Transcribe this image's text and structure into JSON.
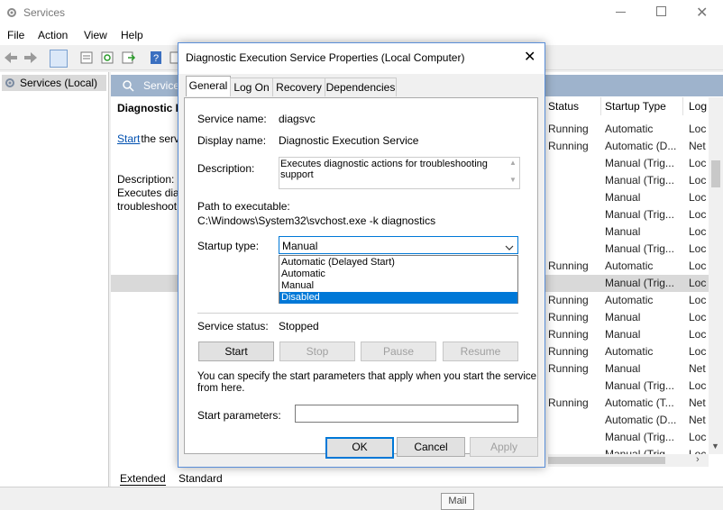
{
  "window": {
    "title": "Services"
  },
  "menu": [
    "File",
    "Action",
    "View",
    "Help"
  ],
  "tree": {
    "root": "Services (Local)"
  },
  "pane": {
    "header": "Services",
    "heading": "Diagnostic E",
    "start_link": "Start",
    "start_text": " the serv",
    "desc_label": "Description:",
    "desc_line1": "Executes diag",
    "desc_line2": "troubleshoot"
  },
  "columns": {
    "status": "Status",
    "startup": "Startup Type",
    "logon": "Log"
  },
  "rows": [
    {
      "status": "Running",
      "startup": "Automatic",
      "logon": "Loc"
    },
    {
      "status": "Running",
      "startup": "Automatic (D...",
      "logon": "Net"
    },
    {
      "status": "",
      "startup": "Manual (Trig...",
      "logon": "Loc"
    },
    {
      "status": "",
      "startup": "Manual (Trig...",
      "logon": "Loc"
    },
    {
      "status": "",
      "startup": "Manual",
      "logon": "Loc"
    },
    {
      "status": "",
      "startup": "Manual (Trig...",
      "logon": "Loc"
    },
    {
      "status": "",
      "startup": "Manual",
      "logon": "Loc"
    },
    {
      "status": "",
      "startup": "Manual (Trig...",
      "logon": "Loc"
    },
    {
      "status": "Running",
      "startup": "Automatic",
      "logon": "Loc"
    },
    {
      "status": "",
      "startup": "Manual (Trig...",
      "logon": "Loc"
    },
    {
      "status": "Running",
      "startup": "Automatic",
      "logon": "Loc"
    },
    {
      "status": "Running",
      "startup": "Manual",
      "logon": "Loc"
    },
    {
      "status": "Running",
      "startup": "Manual",
      "logon": "Loc"
    },
    {
      "status": "Running",
      "startup": "Automatic",
      "logon": "Loc"
    },
    {
      "status": "Running",
      "startup": "Manual",
      "logon": "Net"
    },
    {
      "status": "",
      "startup": "Manual (Trig...",
      "logon": "Loc"
    },
    {
      "status": "Running",
      "startup": "Automatic (T...",
      "logon": "Net"
    },
    {
      "status": "",
      "startup": "Automatic (D...",
      "logon": "Net"
    },
    {
      "status": "",
      "startup": "Manual (Trig...",
      "logon": "Loc"
    },
    {
      "status": "",
      "startup": "Manual (Trig",
      "logon": "Loc"
    }
  ],
  "bottom_tabs": [
    "Extended",
    "Standard"
  ],
  "statusbar": {
    "tooltip": "Mail"
  },
  "dialog": {
    "title": "Diagnostic Execution Service Properties (Local Computer)",
    "tabs": [
      "General",
      "Log On",
      "Recovery",
      "Dependencies"
    ],
    "service_name_label": "Service name:",
    "service_name": "diagsvc",
    "display_name_label": "Display name:",
    "display_name": "Diagnostic Execution Service",
    "description_label": "Description:",
    "description_line1": "Executes diagnostic actions for troubleshooting",
    "description_line2": "support",
    "path_label": "Path to executable:",
    "path": "C:\\Windows\\System32\\svchost.exe -k diagnostics",
    "startup_label": "Startup type:",
    "startup_value": "Manual",
    "startup_options": [
      "Automatic (Delayed Start)",
      "Automatic",
      "Manual",
      "Disabled"
    ],
    "status_label": "Service status:",
    "status_value": "Stopped",
    "buttons": {
      "start": "Start",
      "stop": "Stop",
      "pause": "Pause",
      "resume": "Resume"
    },
    "hint_line1": "You can specify the start parameters that apply when you start the service",
    "hint_line2": "from here.",
    "params_label": "Start parameters:",
    "params_value": "",
    "ok": "OK",
    "cancel": "Cancel",
    "apply": "Apply"
  }
}
